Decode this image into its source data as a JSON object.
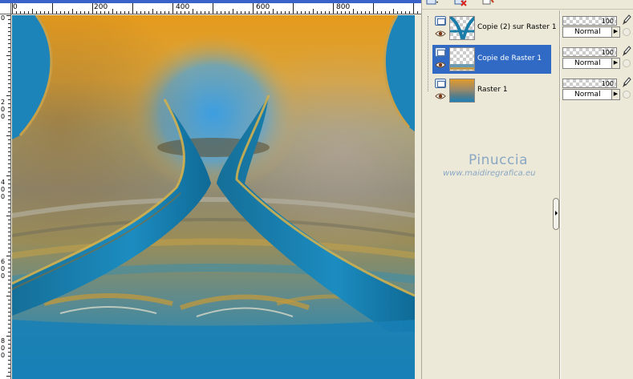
{
  "ruler": {
    "h_labels": [
      "0",
      "200",
      "400",
      "600",
      "800"
    ],
    "v_labels": [
      {
        "group": "v1",
        "chars": [
          "0"
        ]
      },
      {
        "group": "v2",
        "chars": [
          "2",
          "0",
          "0"
        ]
      },
      {
        "group": "v3",
        "chars": [
          "4",
          "0",
          "0"
        ]
      },
      {
        "group": "v4",
        "chars": [
          "6",
          "0",
          "0"
        ]
      },
      {
        "group": "v5",
        "chars": [
          "8",
          "0",
          "0"
        ]
      }
    ]
  },
  "layers": [
    {
      "name": "Copie (2) sur Raster 1",
      "opacity": "100",
      "blend": "Normal",
      "selected": false
    },
    {
      "name": "Copie de Raster 1",
      "opacity": "100",
      "blend": "Normal",
      "selected": true
    },
    {
      "name": "Raster 1",
      "opacity": "100",
      "blend": "Normal",
      "selected": false
    }
  ],
  "watermark": {
    "title": "Pinuccia",
    "url": "www.maidiregrafica.eu"
  },
  "icons": {
    "toolbar": [
      "new-layer-icon",
      "delete-layer-icon",
      "layer-properties-icon"
    ],
    "row": [
      "layer-type-icon",
      "visibility-eye-icon"
    ]
  },
  "colors": {
    "selection": "#316ac5",
    "panel": "#ece9d8"
  }
}
